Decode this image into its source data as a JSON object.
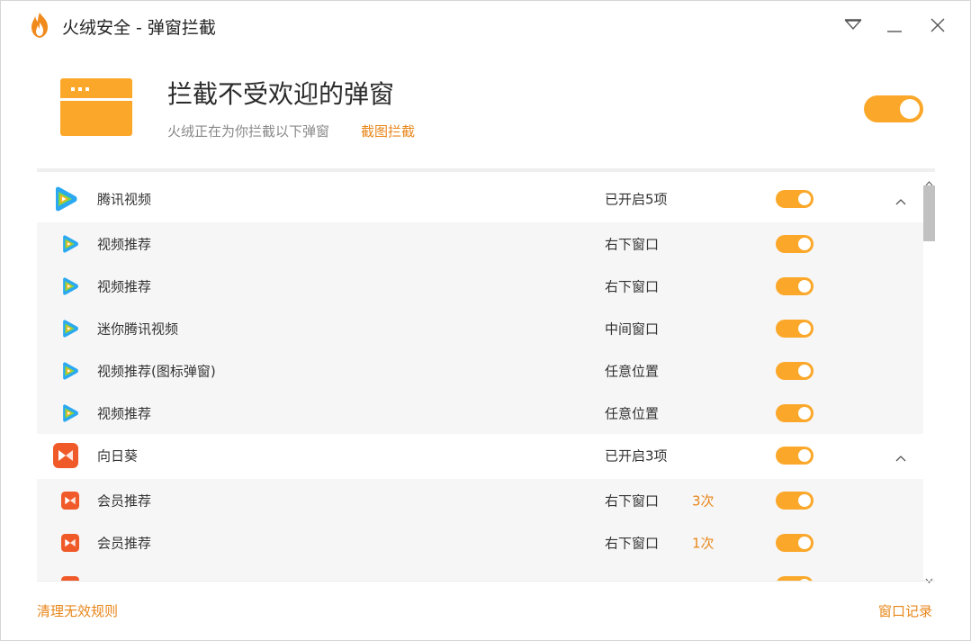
{
  "window": {
    "title": "火绒安全 - 弹窗拦截",
    "controls": [
      "menu-icon",
      "minimize-icon",
      "close-icon"
    ]
  },
  "header": {
    "title": "拦截不受欢迎的弹窗",
    "subtitle": "火绒正在为你拦截以下弹窗",
    "link": "截图拦截",
    "enabled": true
  },
  "groups": [
    {
      "name": "腾讯视频",
      "icon": "tencent-video-icon",
      "status": "已开启5项",
      "enabled": true,
      "expanded": true,
      "items": [
        {
          "name": "视频推荐",
          "position": "右下窗口",
          "count": "",
          "enabled": true
        },
        {
          "name": "视频推荐",
          "position": "右下窗口",
          "count": "",
          "enabled": true
        },
        {
          "name": "迷你腾讯视频",
          "position": "中间窗口",
          "count": "",
          "enabled": true
        },
        {
          "name": "视频推荐(图标弹窗)",
          "position": "任意位置",
          "count": "",
          "enabled": true
        },
        {
          "name": "视频推荐",
          "position": "任意位置",
          "count": "",
          "enabled": true
        }
      ]
    },
    {
      "name": "向日葵",
      "icon": "sunflower-icon",
      "status": "已开启3项",
      "enabled": true,
      "expanded": true,
      "items": [
        {
          "name": "会员推荐",
          "position": "右下窗口",
          "count": "3次",
          "enabled": true
        },
        {
          "name": "会员推荐",
          "position": "右下窗口",
          "count": "1次",
          "enabled": true
        },
        {
          "name": "",
          "position": "",
          "count": "",
          "enabled": true
        }
      ]
    }
  ],
  "footer": {
    "left_link": "清理无效规则",
    "right_link": "窗口记录"
  },
  "colors": {
    "accent": "#fba82a",
    "link": "#e8861a",
    "row_alt": "#f6f6f6"
  }
}
